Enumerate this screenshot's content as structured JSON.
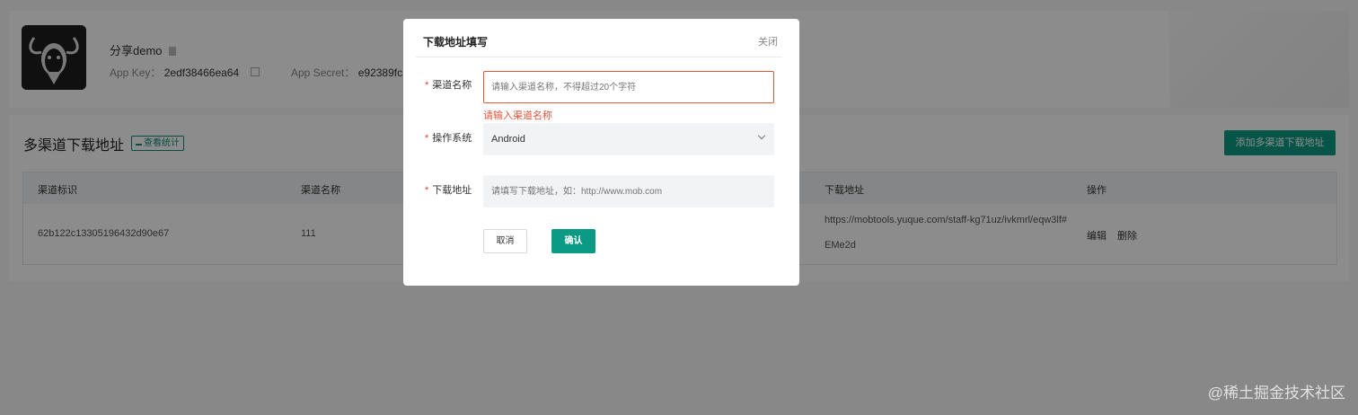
{
  "app": {
    "name": "分享demo",
    "key_label": "App Key：",
    "key_value": "2edf38466ea64",
    "secret_label": "App Secret：",
    "secret_value": "e92389fc"
  },
  "section": {
    "title": "多渠道下载地址",
    "stats_label": "查看统计",
    "add_button": "添加多渠道下载地址"
  },
  "table": {
    "columns": [
      "渠道标识",
      "渠道名称",
      "下载地址",
      "操作"
    ],
    "rows": [
      {
        "channel_id": "62b122c13305196432d90e67",
        "channel_name": "111",
        "url_line1": "https://mobtools.yuque.com/staff-kg71uz/ivkmrl/eqw3lf#",
        "url_line2": "EMe2d",
        "edit": "编辑",
        "delete": "删除"
      }
    ]
  },
  "modal": {
    "title": "下载地址填写",
    "close": "关闭",
    "fields": {
      "channel_name_label": "渠道名称",
      "channel_name_placeholder": "请输入渠道名称，不得超过20个字符",
      "channel_name_error": "请输入渠道名称",
      "os_label": "操作系统",
      "os_value": "Android",
      "url_label": "下载地址",
      "url_placeholder": "请填写下载地址，如：http://www.mob.com"
    },
    "cancel": "取消",
    "confirm": "确认"
  },
  "watermark": "@稀土掘金技术社区",
  "colors": {
    "accent": "#0b9b84",
    "error": "#e0563a"
  }
}
